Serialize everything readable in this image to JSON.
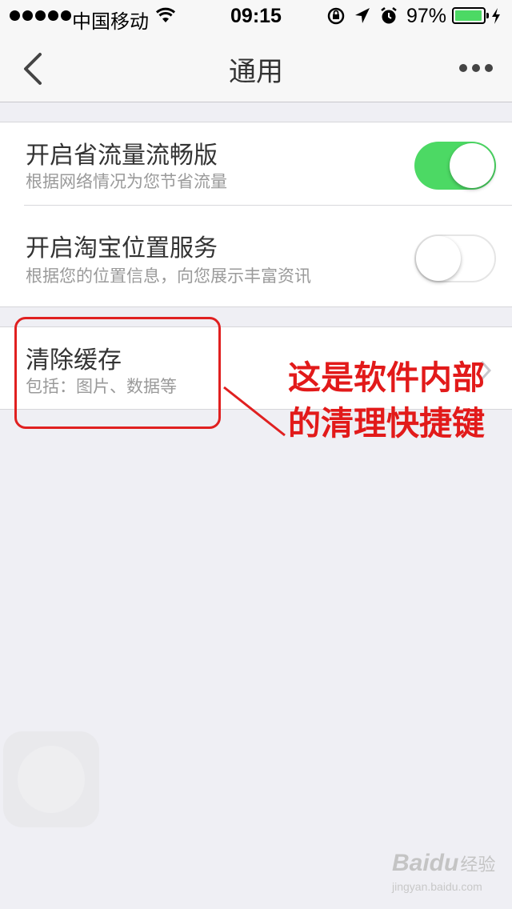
{
  "status_bar": {
    "carrier": "中国移动",
    "time": "09:15",
    "battery_percent": "97%",
    "battery_level": 0.97,
    "icons": [
      "signal-dots-icon",
      "wifi-icon",
      "rotation-lock-icon",
      "location-arrow-icon",
      "alarm-icon",
      "battery-icon",
      "charging-bolt-icon"
    ]
  },
  "nav": {
    "title": "通用",
    "back_icon": "chevron-left-icon",
    "more_icon": "more-dots-icon"
  },
  "settings": {
    "data_saver": {
      "title": "开启省流量流畅版",
      "subtitle": "根据网络情况为您节省流量",
      "enabled": true
    },
    "location": {
      "title": "开启淘宝位置服务",
      "subtitle": "根据您的位置信息，向您展示丰富资讯",
      "enabled": false
    },
    "clear_cache": {
      "title": "清除缓存",
      "subtitle": "包括：图片、数据等"
    }
  },
  "annotation": {
    "text": "这是软件内部的清理快捷键",
    "color": "#e21a1a"
  },
  "watermark": {
    "brand": "Baidu",
    "name": "经验",
    "url": "jingyan.baidu.com"
  },
  "colors": {
    "toggle_on": "#4cd964",
    "annotation_red": "#e02020"
  }
}
